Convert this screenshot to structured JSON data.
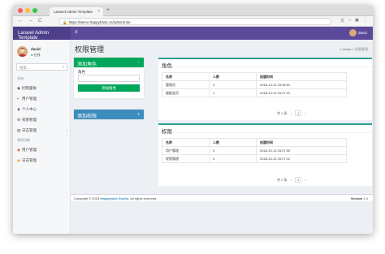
{
  "browser": {
    "tab_title": "Laravel Admin Template",
    "tab_close": "×",
    "new_tab": "+",
    "url": "https://demo.happyhack.cn/admin/role",
    "lock": "🔒",
    "nav_back": "←",
    "nav_forward": "→",
    "nav_reload": "C",
    "ext_icons": [
      "文",
      "☆",
      "▣",
      "⋮"
    ]
  },
  "header": {
    "logo": "Laravel Admin Template",
    "menu_toggle": "≡",
    "user_name": "david"
  },
  "sidebar": {
    "user_name": "david",
    "status_dot": "●",
    "status": "在线",
    "search_placeholder": "搜索...",
    "search_icon": "⌕",
    "section1": "系统",
    "items1": [
      {
        "label": "控制面板",
        "icon": "◉"
      },
      {
        "label": "用户管理",
        "icon": "▪"
      },
      {
        "label": "个人中心",
        "icon": "♟"
      },
      {
        "label": "权限管理",
        "icon": "⚙"
      },
      {
        "label": "日志管理",
        "icon": "▤",
        "chevron": "‹"
      }
    ],
    "section2": "常用功能",
    "items2": [
      {
        "label": "用户管理",
        "icon": "◉"
      },
      {
        "label": "日志管理",
        "icon": "◉"
      }
    ]
  },
  "page": {
    "title": "权限管理",
    "breadcrumb_home_icon": "⌂",
    "breadcrumb_home": "Home",
    "breadcrumb_sep": ">",
    "breadcrumb_current": "权限管理"
  },
  "add_role": {
    "title": "添加角色",
    "toggle": "−",
    "field_label": "角色",
    "button": "添加角色"
  },
  "add_perm": {
    "title": "添加权限",
    "toggle": "+"
  },
  "roles": {
    "title": "角色",
    "columns": [
      "名称",
      "人数",
      "创建时间"
    ],
    "rows": [
      [
        "管理员",
        "2",
        "2018-10-13 15:26:51"
      ],
      [
        "超级会员",
        "1",
        "2018-10-13 15:27:21"
      ]
    ],
    "pager_total": "共 2 条",
    "pager_prev": "‹",
    "pager_page": "1",
    "pager_next": "›"
  },
  "perms": {
    "title": "权限",
    "columns": [
      "名称",
      "人数",
      "创建时间"
    ],
    "rows": [
      [
        "用户管理",
        "0",
        "2018-10-13 15:27:00"
      ],
      [
        "权限管理",
        "0",
        "2018-10-13 15:27:12"
      ]
    ],
    "pager_total": "共 2 条",
    "pager_prev": "‹",
    "pager_page": "1",
    "pager_next": "›"
  },
  "footer": {
    "copyright": "Copyright © 2018",
    "studio": "Happyhack Studio.",
    "rights": "All rights reserved.",
    "version_label": "Version",
    "version": "1.0"
  },
  "colors": {
    "header": "#5b4a9a",
    "add_role_head": "#00a65a",
    "add_perm_head": "#3c8dbc",
    "box_accent": "#2e9e8f"
  }
}
